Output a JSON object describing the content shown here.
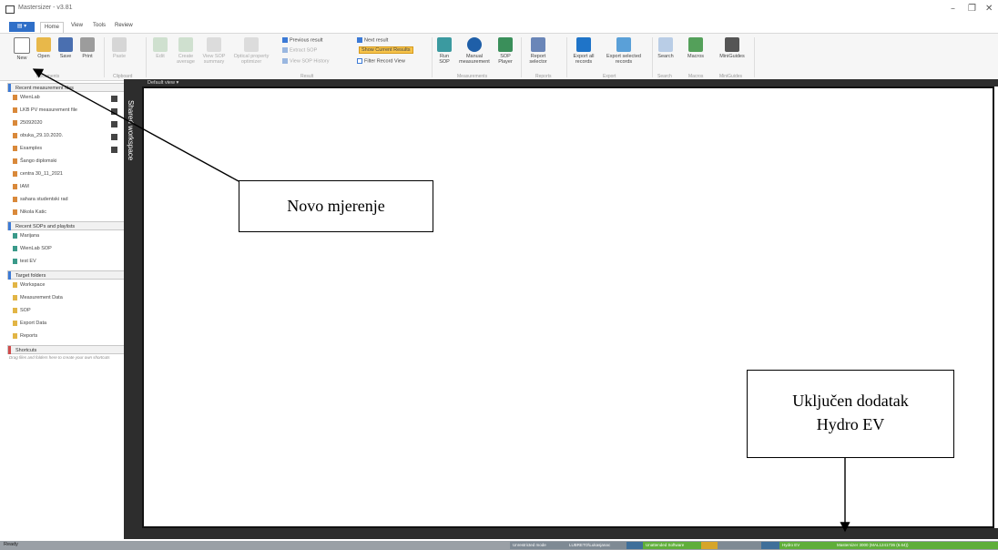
{
  "window": {
    "title": "Mastersizer - v3.81"
  },
  "tabs": {
    "file": "",
    "home": "Home",
    "view": "View",
    "tools": "Tools",
    "review": "Review"
  },
  "ribbon": {
    "new": "New",
    "open": "Open",
    "save": "Save",
    "print": "Print",
    "paste": "Paste",
    "edit": "Edit",
    "create_average": "Create average",
    "view_sop_summary": "View SOP summary",
    "optical_property_optimizer": "Optical property optimizer",
    "previous_result": "Previous result",
    "next_result": "Next result",
    "extract_sop": "Extract SOP",
    "show_current_results": "Show Current Results",
    "view_sop_history": "View SOP History",
    "filter_record_view": "Filter Record View",
    "run_sop": "Run SOP",
    "manual_measurement": "Manual measurement",
    "sop_player": "SOP Player",
    "report_selector": "Report selector",
    "export_all_records": "Export all records",
    "export_selected_records": "Export selected records",
    "search": "Search",
    "macros": "Macros",
    "miniguides": "MiniGuides",
    "groups": {
      "documents": "Documents",
      "clipboard": "Clipboard",
      "result": "Result",
      "measurements": "Measurements",
      "reports": "Reports",
      "export": "Export",
      "search": "Search",
      "macros": "Macros",
      "miniguides": "MiniGuides"
    }
  },
  "sidebar": {
    "recent_files_header": "Recent measurement files",
    "recent_files": [
      "WienLab",
      "LKB PV measurement file",
      "25092020",
      "obuka_29.10.2020.",
      "Examples",
      "Šango diplomski",
      "centra 30_11_2021",
      "IAM",
      "sahara studentski rad",
      "Nikola Katic"
    ],
    "recent_sops_header": "Recent SOPs and playlists",
    "recent_sops": [
      "Marijana",
      "WienLab SOP",
      "test EV"
    ],
    "target_header": "Target folders",
    "targets": [
      "Workspace",
      "Measurement Data",
      "SOP",
      "Export Data",
      "Reports"
    ],
    "shortcuts_header": "Shortcuts",
    "shortcuts_hint": "Drag files and folders here to create your own shortcuts"
  },
  "workspace": {
    "vertical_label": "Shared workspace",
    "default_view_tab": "Default view ▾"
  },
  "status": {
    "ready": "Ready",
    "segments": [
      "Unrestricted mode",
      "LUBRETO\\Lukasjanac",
      "",
      "Unattended Software",
      "",
      "",
      "Hydro EV",
      "Mastersizer 3000 (MAL1241736 (6.64))"
    ]
  },
  "callouts": {
    "new_measurement": "Novo mjerenje",
    "hydro_line1": "Uključen dodatak",
    "hydro_line2": "Hydro EV"
  },
  "colors": {
    "accent": "#2f6fc8",
    "dark_panel": "#2d2d2d",
    "highlight": "#f6c34a",
    "status_green": "#5fae3a"
  }
}
